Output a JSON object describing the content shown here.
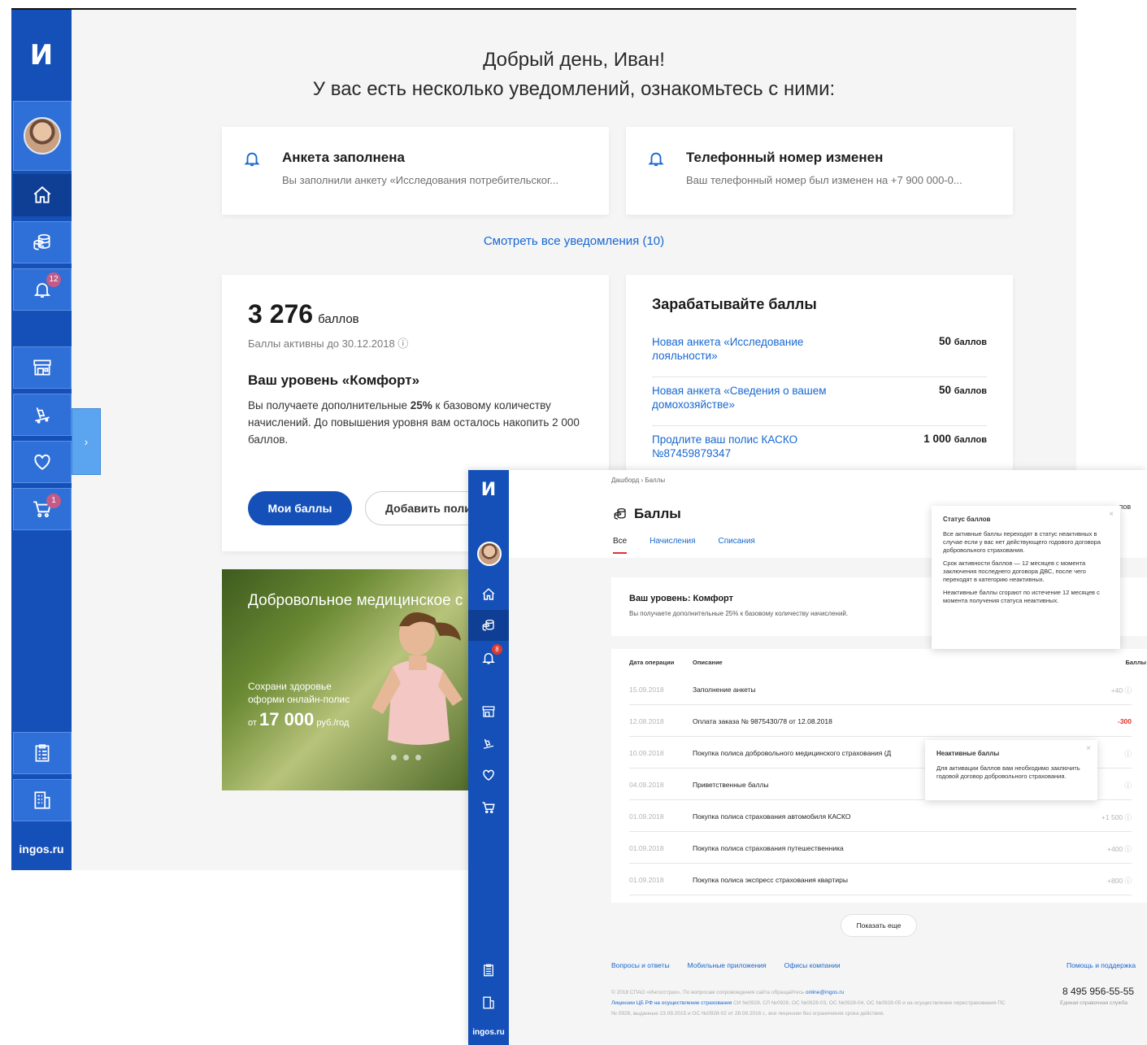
{
  "screen1": {
    "logo": "И",
    "sidebar_badges": {
      "notifications": "12",
      "cart": "1"
    },
    "sidebar_site": "ingos.ru",
    "expander_glyph": "›",
    "greeting_line1": "Добрый день, Иван!",
    "greeting_line2": "У вас есть несколько уведомлений, ознакомьтесь с ними:",
    "notifications": [
      {
        "title": "Анкета заполнена",
        "text": "Вы заполнили анкету «Исследования потребительског..."
      },
      {
        "title": "Телефонный номер изменен",
        "text": "Ваш телефонный номер был изменен на +7 900 000-0..."
      }
    ],
    "all_notifications_link": "Смотреть все уведомления (10)",
    "points": {
      "value": "3 276",
      "unit": "баллов",
      "active_until": "Баллы активны до 30.12.2018 ⓘ",
      "level_title": "Ваш уровень «Комфорт»",
      "desc_pre": "Вы получаете дополнительные ",
      "desc_bold": "25%",
      "desc_post": " к базовому количеству начислений. До повышения уровня вам осталось накопить 2 000 баллов.",
      "btn_primary": "Мои баллы",
      "btn_secondary": "Добавить поли"
    },
    "earn": {
      "title": "Зарабатывайте баллы",
      "rows": [
        {
          "link": "Новая анкета «Исследование лояльности»",
          "value": "50",
          "unit": "баллов"
        },
        {
          "link": "Новая анкета «Сведения о вашем домохозяйстве»",
          "value": "50",
          "unit": "баллов"
        },
        {
          "link": "Продлите ваш полис КАСКО №87459879347",
          "value": "1 000",
          "unit": "баллов"
        }
      ]
    },
    "promo": {
      "title": "Добровольное медицинское с",
      "line1": "Сохрани здоровье",
      "line2": "оформи онлайн-полис",
      "price_prefix": "от",
      "price": "17 000",
      "price_unit": "руб./год"
    }
  },
  "screen2": {
    "logo": "И",
    "badge": "8",
    "site": "ingos.ru",
    "expander_glyph": "›",
    "breadcrumb": "Дашборд  ›  Баллы",
    "title": "Баллы",
    "tabs": [
      "Все",
      "Начисления",
      "Списания"
    ],
    "corner_text": "лов",
    "level_title": "Ваш уровень: Комфорт",
    "level_desc": "Вы получаете дополнительные 25% к базовому количеству начислений.",
    "table_headers": {
      "date": "Дата операции",
      "desc": "Описание",
      "points": "Баллы"
    },
    "rows": [
      {
        "date": "15.09.2018",
        "desc": "Заполнение анкеты",
        "points": "+40 ⓘ",
        "negative": false
      },
      {
        "date": "12.08.2018",
        "desc": "Оплата заказа № 9875430/78 от 12.08.2018",
        "points": "-300",
        "negative": true
      },
      {
        "date": "10.09.2018",
        "desc": "Покупка полиса добровольного медицинского страхования (Д",
        "points": "ⓘ",
        "negative": false
      },
      {
        "date": "04.09.2018",
        "desc": "Приветственные баллы",
        "points": "ⓘ",
        "negative": false
      },
      {
        "date": "01.09.2018",
        "desc": "Покупка полиса страхования автомобиля КАСКО",
        "points": "+1 500 ⓘ",
        "negative": false
      },
      {
        "date": "01.09.2018",
        "desc": "Покупка полиса страхования путешественника",
        "points": "+400 ⓘ",
        "negative": false
      },
      {
        "date": "01.09.2018",
        "desc": "Покупка полиса экспресс страхования квартиры",
        "points": "+800 ⓘ",
        "negative": false
      }
    ],
    "show_more": "Показать еще",
    "footer_links": [
      "Вопросы и ответы",
      "Мобильные приложения",
      "Офисы компании"
    ],
    "help_link": "Помощь и поддержка",
    "phone": "8 495 956-55-55",
    "phone_sub": "Единая справочная служба",
    "legal1": "© 2018 СПАО «Ингосстрах». По вопросам сопровождения сайта обращайтесь ",
    "legal_email": "online@ingos.ru",
    "legal2_link": "Лицензии ЦБ РФ на осуществление страхования",
    "legal2": " СИ №0928, СЛ №0928, ОС №0928-03, ОС №0928-04, ОС №0928-05 и на осуществление перестрахования ПС № 0928, выданные 23.09.2015 и ОС №0928-02 от 28.09.2016 г., все лицензии без ограничения срока действия.",
    "tooltip_status": {
      "close": "×",
      "title": "Статус баллов",
      "p1": "Все активные баллы переходят в статус неактивных в случае если у вас нет действующего годового договора добровольного страхования.",
      "p2": "Срок активности баллов — 12 месяцев с момента заключения последнего договора ДВС, после чего переходят в категорию неактивных.",
      "p3": "Неактивные баллы сгорают по истечение 12 месяцев с момента получения статуса неактивных."
    },
    "tooltip_inactive": {
      "close": "×",
      "title": "Неактивные баллы",
      "p1": "Для активации баллов вам необходимо заключить годовой договор добровольного страхования."
    }
  }
}
